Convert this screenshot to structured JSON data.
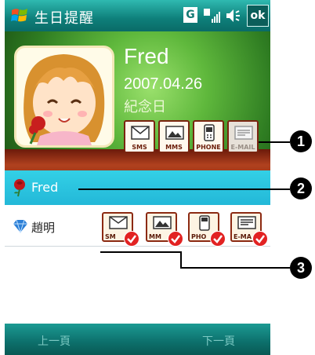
{
  "titlebar": {
    "title": "生日提醒",
    "g_badge": "G",
    "ok_label": "ok",
    "icons": [
      "windows-start-icon",
      "signal-icon",
      "volume-icon"
    ]
  },
  "header": {
    "name": "Fred",
    "date": "2007.04.26",
    "subtitle": "紀念日",
    "buttons": [
      {
        "label": "SMS",
        "icon": "envelope-icon"
      },
      {
        "label": "MMS",
        "icon": "picture-icon"
      },
      {
        "label": "PHONE",
        "icon": "phone-icon"
      },
      {
        "label": "E-MAIL",
        "icon": "email-icon",
        "dimmed": true
      }
    ]
  },
  "list": {
    "selected": {
      "label": "Fred",
      "icon": "rose-icon"
    },
    "rows": [
      {
        "label": "趙明",
        "icon": "diamond-icon",
        "buttons": [
          {
            "label": "SM",
            "icon": "envelope-icon",
            "checked": true
          },
          {
            "label": "MM",
            "icon": "picture-icon",
            "checked": true
          },
          {
            "label": "PHO",
            "icon": "phone-icon",
            "checked": true
          },
          {
            "label": "E-MA",
            "icon": "email-icon",
            "checked": true
          }
        ]
      }
    ]
  },
  "softkeys": {
    "left": "上一頁",
    "right": "下一頁"
  },
  "callouts": [
    "1",
    "2",
    "3"
  ],
  "colors": {
    "title_bar": "#0e7f7a",
    "selected_row": "#28c2dc",
    "check": "#e22222"
  }
}
